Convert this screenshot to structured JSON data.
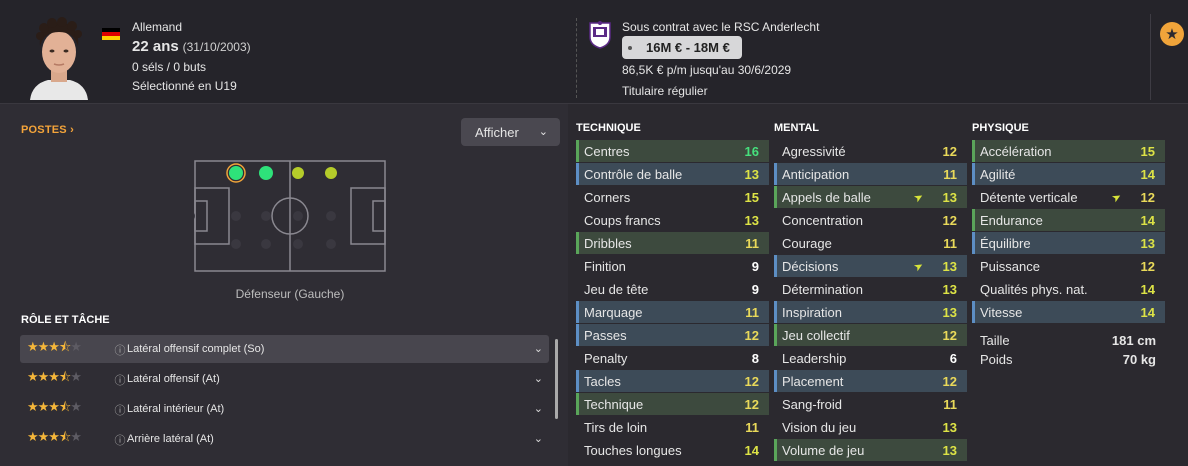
{
  "header": {
    "nationality": "Allemand",
    "age": "22 ans",
    "birth": "(31/10/2003)",
    "caps": "0 séls / 0 buts",
    "selection": "Sélectionné en U19",
    "flag_colors": [
      "#000000",
      "#dd0000",
      "#ffce00"
    ]
  },
  "contract": {
    "club_line": "Sous contrat avec le RSC Anderlecht",
    "value": "16M € - 18M €",
    "wage": "86,5K € p/m jusqu'au 30/6/2029",
    "status": "Titulaire régulier"
  },
  "positions": {
    "title": "POSTES",
    "show_button": "Afficher",
    "label": "Défenseur (Gauche)"
  },
  "roles": {
    "title": "RÔLE ET TÂCHE",
    "items": [
      {
        "name": "Latéral offensif complet (So)",
        "stars": 3.5
      },
      {
        "name": "Latéral offensif (At)",
        "stars": 3.5
      },
      {
        "name": "Latéral intérieur (At)",
        "stars": 3.5
      },
      {
        "name": "Arrière latéral (At)",
        "stars": 3.5
      }
    ]
  },
  "technique": {
    "title": "TECHNIQUE",
    "items": [
      {
        "name": "Centres",
        "value": "16",
        "hl": "green"
      },
      {
        "name": "Contrôle de balle",
        "value": "13",
        "hl": "blue"
      },
      {
        "name": "Corners",
        "value": "15",
        "hl": ""
      },
      {
        "name": "Coups francs",
        "value": "13",
        "hl": ""
      },
      {
        "name": "Dribbles",
        "value": "11",
        "hl": "green"
      },
      {
        "name": "Finition",
        "value": "9",
        "hl": ""
      },
      {
        "name": "Jeu de tête",
        "value": "9",
        "hl": ""
      },
      {
        "name": "Marquage",
        "value": "11",
        "hl": "blue"
      },
      {
        "name": "Passes",
        "value": "12",
        "hl": "blue"
      },
      {
        "name": "Penalty",
        "value": "8",
        "hl": ""
      },
      {
        "name": "Tacles",
        "value": "12",
        "hl": "blue"
      },
      {
        "name": "Technique",
        "value": "12",
        "hl": "green"
      },
      {
        "name": "Tirs de loin",
        "value": "11",
        "hl": ""
      },
      {
        "name": "Touches longues",
        "value": "14",
        "hl": ""
      }
    ]
  },
  "mental": {
    "title": "MENTAL",
    "items": [
      {
        "name": "Agressivité",
        "value": "12",
        "hl": ""
      },
      {
        "name": "Anticipation",
        "value": "11",
        "hl": "blue"
      },
      {
        "name": "Appels de balle",
        "value": "13",
        "hl": "green",
        "arrow": true
      },
      {
        "name": "Concentration",
        "value": "12",
        "hl": ""
      },
      {
        "name": "Courage",
        "value": "11",
        "hl": ""
      },
      {
        "name": "Décisions",
        "value": "13",
        "hl": "blue",
        "arrow": true
      },
      {
        "name": "Détermination",
        "value": "13",
        "hl": ""
      },
      {
        "name": "Inspiration",
        "value": "13",
        "hl": "blue"
      },
      {
        "name": "Jeu collectif",
        "value": "12",
        "hl": "green"
      },
      {
        "name": "Leadership",
        "value": "6",
        "hl": ""
      },
      {
        "name": "Placement",
        "value": "12",
        "hl": "blue"
      },
      {
        "name": "Sang-froid",
        "value": "11",
        "hl": ""
      },
      {
        "name": "Vision du jeu",
        "value": "13",
        "hl": ""
      },
      {
        "name": "Volume de jeu",
        "value": "13",
        "hl": "green"
      }
    ]
  },
  "physique": {
    "title": "PHYSIQUE",
    "items": [
      {
        "name": "Accélération",
        "value": "15",
        "hl": "green"
      },
      {
        "name": "Agilité",
        "value": "14",
        "hl": "blue"
      },
      {
        "name": "Détente verticale",
        "value": "12",
        "hl": "",
        "arrow": true
      },
      {
        "name": "Endurance",
        "value": "14",
        "hl": "green"
      },
      {
        "name": "Équilibre",
        "value": "13",
        "hl": "blue"
      },
      {
        "name": "Puissance",
        "value": "12",
        "hl": ""
      },
      {
        "name": "Qualités phys. nat.",
        "value": "14",
        "hl": ""
      },
      {
        "name": "Vitesse",
        "value": "14",
        "hl": "blue"
      }
    ],
    "height_label": "Taille",
    "height": "181 cm",
    "weight_label": "Poids",
    "weight": "70 kg"
  }
}
